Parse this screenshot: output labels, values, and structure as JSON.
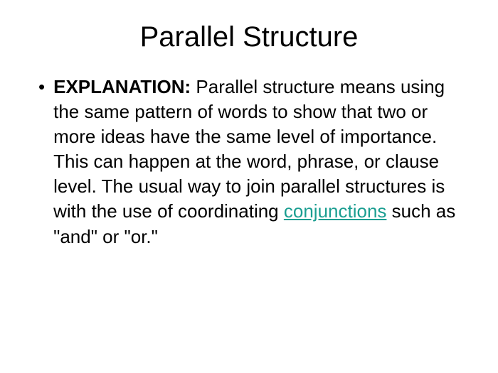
{
  "title": "Parallel Structure",
  "bullet": "•",
  "label": "EXPLANATION:",
  "text_before_link": " Parallel structure means using the same pattern of words to show that two or more ideas have the same level of importance. This can happen at the word, phrase, or clause level. The usual way to join parallel structures is with the use of coordinating ",
  "link_text": "conjunctions",
  "text_after_link": " such as \"and\" or \"or.\""
}
